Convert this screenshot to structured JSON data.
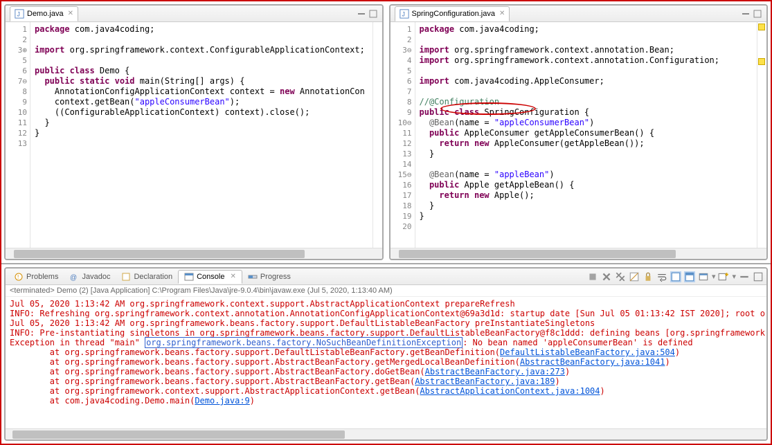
{
  "editors": {
    "left": {
      "tab_label": "Demo.java",
      "gutter": "  1\n  2\n  3⊕\n  5\n  6\n  7⊖\n  8\n  9\n 10\n 11\n 12\n 13",
      "lines": [
        {
          "t": "pkg",
          "pkgkw": "package",
          "pkg": " com.java4coding;"
        },
        {
          "t": "blank"
        },
        {
          "t": "imp",
          "impkw": "import",
          "imp": " org.springframework.context.ConfigurableApplicationContext;"
        },
        {
          "t": "blank"
        },
        {
          "t": "classdecl",
          "pre": "public class",
          "name": " Demo {"
        },
        {
          "t": "main",
          "indent": "  ",
          "mods": "public static void",
          "sig": " main(String[] args) {"
        },
        {
          "t": "plain",
          "indent": "    ",
          "txt1": "AnnotationConfigApplicationContext context = ",
          "kw": "new",
          "txt2": " AnnotationCon"
        },
        {
          "t": "call",
          "indent": "    ",
          "txt": "context.getBean(",
          "str": "\"appleConsumerBean\"",
          "tail": ");"
        },
        {
          "t": "plain2",
          "indent": "    ",
          "txt": "((ConfigurableApplicationContext) context).close();"
        },
        {
          "t": "brace",
          "indent": "  ",
          "txt": "}"
        },
        {
          "t": "brace",
          "indent": "",
          "txt": "}"
        },
        {
          "t": "blank"
        }
      ]
    },
    "right": {
      "tab_label": "SpringConfiguration.java",
      "gutter": "  1\n  2\n  3⊖\n  4\n  5\n  6\n  7\n  8\n  9\n 10⊖\n 11\n 12\n 13\n 14\n 15⊖\n 16\n 17\n 18\n 19\n 20",
      "lines": [
        {
          "t": "pkg",
          "pkgkw": "package",
          "pkg": " com.java4coding;"
        },
        {
          "t": "blank"
        },
        {
          "t": "imp",
          "impkw": "import",
          "imp": " org.springframework.context.annotation.Bean;"
        },
        {
          "t": "imp",
          "impkw": "import",
          "imp": " org.springframework.context.annotation.Configuration;"
        },
        {
          "t": "blank"
        },
        {
          "t": "imp",
          "impkw": "import",
          "imp": " com.java4coding.AppleConsumer;"
        },
        {
          "t": "blank"
        },
        {
          "t": "com",
          "txt": "//@Configuration"
        },
        {
          "t": "classdecl",
          "pre": "public class",
          "name": " SpringConfiguration {"
        },
        {
          "t": "ann",
          "indent": "  ",
          "ann": "@Bean",
          "args": "(name = ",
          "str": "\"appleConsumerBean\"",
          "tail": ")"
        },
        {
          "t": "meth",
          "indent": "  ",
          "mods": "public",
          "sig": " AppleConsumer getAppleConsumerBean() {"
        },
        {
          "t": "ret",
          "indent": "    ",
          "kw": "return new",
          "txt": " AppleConsumer(getAppleBean());"
        },
        {
          "t": "brace",
          "indent": "  ",
          "txt": "}"
        },
        {
          "t": "blank"
        },
        {
          "t": "ann",
          "indent": "  ",
          "ann": "@Bean",
          "args": "(name = ",
          "str": "\"appleBean\"",
          "tail": ")"
        },
        {
          "t": "meth",
          "indent": "  ",
          "mods": "public",
          "sig": " Apple getAppleBean() {"
        },
        {
          "t": "ret",
          "indent": "    ",
          "kw": "return new",
          "txt": " Apple();"
        },
        {
          "t": "brace",
          "indent": "  ",
          "txt": "}"
        },
        {
          "t": "brace",
          "indent": "",
          "txt": "}"
        },
        {
          "t": "blank"
        }
      ]
    }
  },
  "bottom": {
    "tabs": {
      "problems": "Problems",
      "javadoc": "Javadoc",
      "declaration": "Declaration",
      "console": "Console",
      "progress": "Progress"
    },
    "terminated": "<terminated> Demo (2) [Java Application] C:\\Program Files\\Java\\jre-9.0.4\\bin\\javaw.exe (Jul 5, 2020, 1:13:40 AM)",
    "lines": [
      "Jul 05, 2020 1:13:42 AM org.springframework.context.support.AbstractApplicationContext prepareRefresh",
      "INFO: Refreshing org.springframework.context.annotation.AnnotationConfigApplicationContext@69a3d1d: startup date [Sun Jul 05 01:13:42 IST 2020]; root o",
      "Jul 05, 2020 1:13:42 AM org.springframework.beans.factory.support.DefaultListableBeanFactory preInstantiateSingletons",
      "INFO: Pre-instantiating singletons in org.springframework.beans.factory.support.DefaultListableBeanFactory@f8c1ddd: defining beans [org.springframework"
    ],
    "exception_pre": "Exception in thread \"main\" ",
    "exception_link": "org.springframework.beans.factory.NoSuchBeanDefinitionException",
    "exception_post": ": No bean named 'appleConsumerBean' is defined",
    "stack": [
      {
        "pre": "        at org.springframework.beans.factory.support.DefaultListableBeanFactory.getBeanDefinition(",
        "lnk": "DefaultListableBeanFactory.java:504",
        "post": ")"
      },
      {
        "pre": "        at org.springframework.beans.factory.support.AbstractBeanFactory.getMergedLocalBeanDefinition(",
        "lnk": "AbstractBeanFactory.java:1041",
        "post": ")"
      },
      {
        "pre": "        at org.springframework.beans.factory.support.AbstractBeanFactory.doGetBean(",
        "lnk": "AbstractBeanFactory.java:273",
        "post": ")"
      },
      {
        "pre": "        at org.springframework.beans.factory.support.AbstractBeanFactory.getBean(",
        "lnk": "AbstractBeanFactory.java:189",
        "post": ")"
      },
      {
        "pre": "        at org.springframework.context.support.AbstractApplicationContext.getBean(",
        "lnk": "AbstractApplicationContext.java:1004",
        "post": ")"
      },
      {
        "pre": "        at com.java4coding.Demo.main(",
        "lnk": "Demo.java:9",
        "post": ")"
      }
    ]
  }
}
